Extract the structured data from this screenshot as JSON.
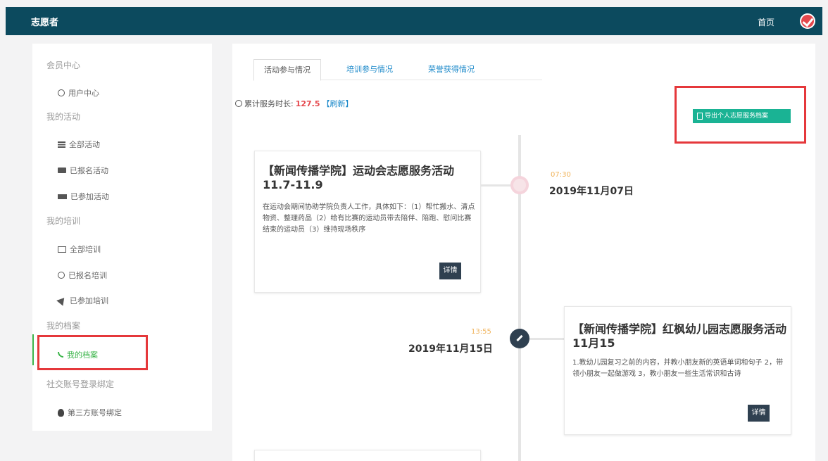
{
  "header": {
    "brand": "志愿者",
    "home": "首页"
  },
  "sidebar": {
    "groups": [
      {
        "label": "会员中心",
        "items": [
          {
            "label": "用户中心",
            "icon": "user-circle-icon"
          }
        ]
      },
      {
        "label": "我的活动",
        "items": [
          {
            "label": "全部活动",
            "icon": "list-icon"
          },
          {
            "label": "已报名活动",
            "icon": "tag-icon"
          },
          {
            "label": "已参加活动",
            "icon": "ticket-icon"
          }
        ]
      },
      {
        "label": "我的培训",
        "items": [
          {
            "label": "全部培训",
            "icon": "monitor-icon"
          },
          {
            "label": "已报名培训",
            "icon": "gear-icon"
          },
          {
            "label": "已参加培训",
            "icon": "send-icon"
          }
        ]
      },
      {
        "label": "我的档案",
        "items": [
          {
            "label": "我的档案",
            "icon": "rss-icon",
            "active": true
          }
        ]
      },
      {
        "label": "社交账号登录绑定",
        "items": [
          {
            "label": "第三方账号绑定",
            "icon": "penguin-icon"
          }
        ]
      }
    ]
  },
  "tabs": [
    "活动参与情况",
    "培训参与情况",
    "荣誉获得情况"
  ],
  "summary": {
    "prefix": "累计服务时长:",
    "hours": "127.5",
    "refresh": "【刷新】"
  },
  "export_button": "导出个人志愿服务档案",
  "timeline": [
    {
      "title": "【新闻传播学院】运动会志愿服务活动11.7-11.9",
      "desc": "在运动会期间协助学院负责人工作，具体如下：（1）帮忙搬水、清点物资、整理药品（2）给有比赛的运动员带去陪伴、陪跑、慰问比赛结束的运动员（3）维持现场秩序",
      "time": "07:30",
      "date": "2019年11月07日",
      "detail": "详情"
    },
    {
      "title": "【新闻传播学院】红枫幼儿园志愿服务活动11月15",
      "desc": "1.教幼儿园复习之前的内容，并教小朋友新的英语单词和句子 2，带领小朋友一起做游戏 3，教小朋友一些生活常识和古诗",
      "time": "13:55",
      "date": "2019年11月15日",
      "detail": "详情"
    }
  ],
  "colors": {
    "topbar": "#0c4a5e",
    "accent": "#1ab394",
    "hours": "#e5484d",
    "highlight_box": "#e5383b"
  }
}
